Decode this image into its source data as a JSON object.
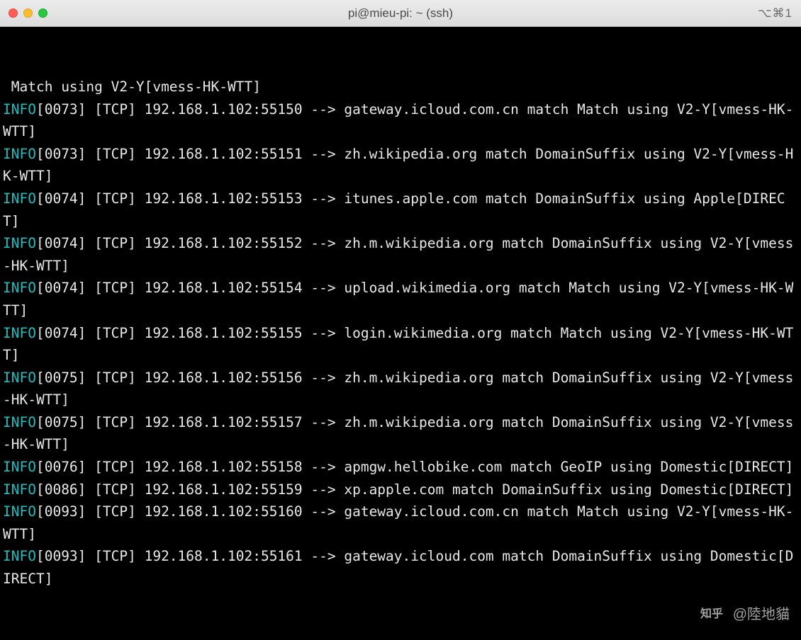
{
  "titlebar": {
    "title": "pi@mieu-pi: ~ (ssh)",
    "shortcut": "⌥⌘1"
  },
  "lines": [
    {
      "info": false,
      "text": " Match using V2-Y[vmess-HK-WTT]"
    },
    {
      "info": true,
      "text": "[0073] [TCP] 192.168.1.102:55150 --> gateway.icloud.com.cn match Match using V2-Y[vmess-HK-WTT]"
    },
    {
      "info": true,
      "text": "[0073] [TCP] 192.168.1.102:55151 --> zh.wikipedia.org match DomainSuffix using V2-Y[vmess-HK-WTT]"
    },
    {
      "info": true,
      "text": "[0074] [TCP] 192.168.1.102:55153 --> itunes.apple.com match DomainSuffix using Apple[DIRECT]"
    },
    {
      "info": true,
      "text": "[0074] [TCP] 192.168.1.102:55152 --> zh.m.wikipedia.org match DomainSuffix using V2-Y[vmess-HK-WTT]"
    },
    {
      "info": true,
      "text": "[0074] [TCP] 192.168.1.102:55154 --> upload.wikimedia.org match Match using V2-Y[vmess-HK-WTT]"
    },
    {
      "info": true,
      "text": "[0074] [TCP] 192.168.1.102:55155 --> login.wikimedia.org match Match using V2-Y[vmess-HK-WTT]"
    },
    {
      "info": true,
      "text": "[0075] [TCP] 192.168.1.102:55156 --> zh.m.wikipedia.org match DomainSuffix using V2-Y[vmess-HK-WTT]"
    },
    {
      "info": true,
      "text": "[0075] [TCP] 192.168.1.102:55157 --> zh.m.wikipedia.org match DomainSuffix using V2-Y[vmess-HK-WTT]"
    },
    {
      "info": true,
      "text": "[0076] [TCP] 192.168.1.102:55158 --> apmgw.hellobike.com match GeoIP using Domestic[DIRECT]"
    },
    {
      "info": true,
      "text": "[0086] [TCP] 192.168.1.102:55159 --> xp.apple.com match DomainSuffix using Domestic[DIRECT]"
    },
    {
      "info": true,
      "text": "[0093] [TCP] 192.168.1.102:55160 --> gateway.icloud.com.cn match Match using V2-Y[vmess-HK-WTT]"
    },
    {
      "info": true,
      "text": "[0093] [TCP] 192.168.1.102:55161 --> gateway.icloud.com match DomainSuffix using Domestic[DIRECT]"
    }
  ],
  "info_label": "INFO",
  "watermark": {
    "text": "@陸地貓",
    "brand": "知乎"
  }
}
